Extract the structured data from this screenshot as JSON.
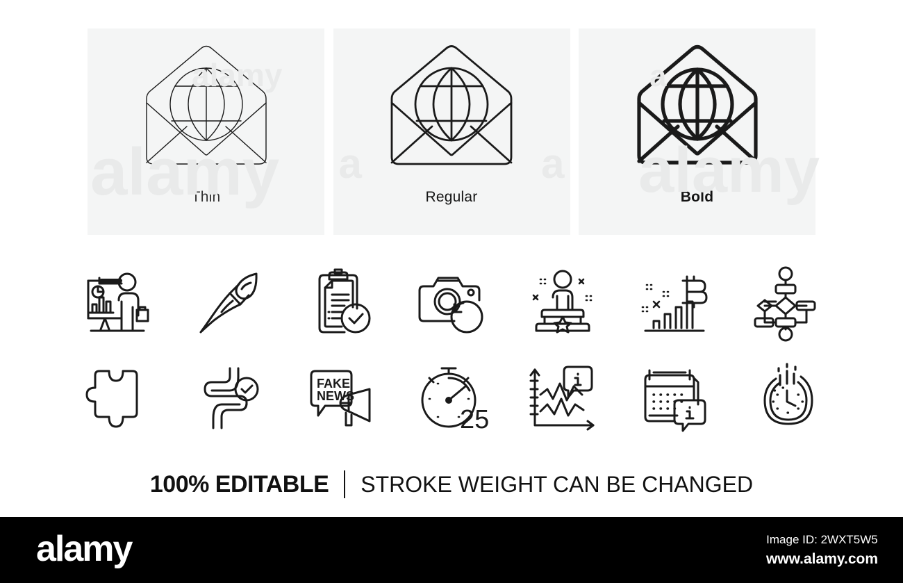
{
  "page": {
    "background": "#ffffff",
    "panel_background": "#f4f5f5",
    "stroke_color": "#1a1a1a",
    "footer_background": "#000000"
  },
  "weights": {
    "panels": [
      {
        "label": "Thin",
        "icon": "open-mail-globe-icon",
        "stroke_width": 1.4
      },
      {
        "label": "Regular",
        "icon": "open-mail-globe-icon",
        "stroke_width": 2.6
      },
      {
        "label": "Bold",
        "icon": "open-mail-globe-icon",
        "stroke_width": 4.6
      }
    ],
    "watermark_text": "alamy"
  },
  "icon_grid": {
    "rows": [
      [
        {
          "name": "presentation-icon",
          "title": "Presentation"
        },
        {
          "name": "paint-brush-icon",
          "title": "Paint brush"
        },
        {
          "name": "checklist-icon",
          "title": "Checklist"
        },
        {
          "name": "photo-recovery-icon",
          "title": "Photo recovery"
        },
        {
          "name": "winner-podium-icon",
          "title": "Winner podium"
        },
        {
          "name": "bitcoin-graph-icon",
          "title": "Bitcoin graph"
        },
        {
          "name": "block-diagram-icon",
          "title": "Block diagram"
        }
      ],
      [
        {
          "name": "puzzle-icon",
          "title": "Puzzle"
        },
        {
          "name": "intestine-check-icon",
          "title": "Intestine"
        },
        {
          "name": "fake-news-icon",
          "title": "Fake news",
          "bubble_text_line1": "FAKE",
          "bubble_text_line2": "NEWS"
        },
        {
          "name": "timer-icon",
          "title": "Timer",
          "value": "25"
        },
        {
          "name": "info-chart-icon",
          "title": "Info chart",
          "badge": "i"
        },
        {
          "name": "calendar-info-icon",
          "title": "Calendar info",
          "badge": "i"
        },
        {
          "name": "fast-time-icon",
          "title": "Fast time"
        }
      ]
    ]
  },
  "tagline": {
    "bold_text": "100% EDITABLE",
    "separator": "|",
    "regular_text": "STROKE WEIGHT CAN BE CHANGED"
  },
  "footer": {
    "logo": "alamy",
    "image_id_label": "Image ID: 2WXT5W5",
    "url": "www.alamy.com"
  }
}
